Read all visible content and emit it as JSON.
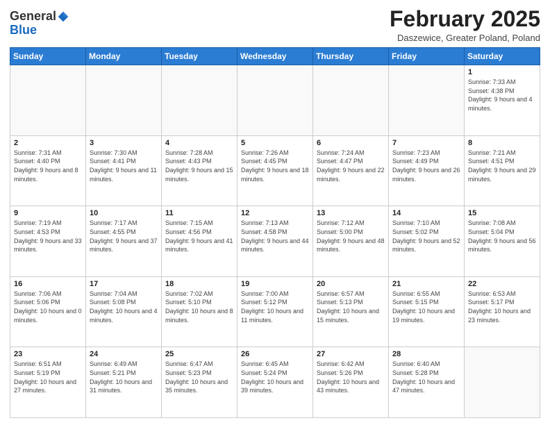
{
  "header": {
    "logo_general": "General",
    "logo_blue": "Blue",
    "main_title": "February 2025",
    "subtitle": "Daszewice, Greater Poland, Poland"
  },
  "weekdays": [
    "Sunday",
    "Monday",
    "Tuesday",
    "Wednesday",
    "Thursday",
    "Friday",
    "Saturday"
  ],
  "weeks": [
    [
      {
        "day": "",
        "info": ""
      },
      {
        "day": "",
        "info": ""
      },
      {
        "day": "",
        "info": ""
      },
      {
        "day": "",
        "info": ""
      },
      {
        "day": "",
        "info": ""
      },
      {
        "day": "",
        "info": ""
      },
      {
        "day": "1",
        "info": "Sunrise: 7:33 AM\nSunset: 4:38 PM\nDaylight: 9 hours and 4 minutes."
      }
    ],
    [
      {
        "day": "2",
        "info": "Sunrise: 7:31 AM\nSunset: 4:40 PM\nDaylight: 9 hours and 8 minutes."
      },
      {
        "day": "3",
        "info": "Sunrise: 7:30 AM\nSunset: 4:41 PM\nDaylight: 9 hours and 11 minutes."
      },
      {
        "day": "4",
        "info": "Sunrise: 7:28 AM\nSunset: 4:43 PM\nDaylight: 9 hours and 15 minutes."
      },
      {
        "day": "5",
        "info": "Sunrise: 7:26 AM\nSunset: 4:45 PM\nDaylight: 9 hours and 18 minutes."
      },
      {
        "day": "6",
        "info": "Sunrise: 7:24 AM\nSunset: 4:47 PM\nDaylight: 9 hours and 22 minutes."
      },
      {
        "day": "7",
        "info": "Sunrise: 7:23 AM\nSunset: 4:49 PM\nDaylight: 9 hours and 26 minutes."
      },
      {
        "day": "8",
        "info": "Sunrise: 7:21 AM\nSunset: 4:51 PM\nDaylight: 9 hours and 29 minutes."
      }
    ],
    [
      {
        "day": "9",
        "info": "Sunrise: 7:19 AM\nSunset: 4:53 PM\nDaylight: 9 hours and 33 minutes."
      },
      {
        "day": "10",
        "info": "Sunrise: 7:17 AM\nSunset: 4:55 PM\nDaylight: 9 hours and 37 minutes."
      },
      {
        "day": "11",
        "info": "Sunrise: 7:15 AM\nSunset: 4:56 PM\nDaylight: 9 hours and 41 minutes."
      },
      {
        "day": "12",
        "info": "Sunrise: 7:13 AM\nSunset: 4:58 PM\nDaylight: 9 hours and 44 minutes."
      },
      {
        "day": "13",
        "info": "Sunrise: 7:12 AM\nSunset: 5:00 PM\nDaylight: 9 hours and 48 minutes."
      },
      {
        "day": "14",
        "info": "Sunrise: 7:10 AM\nSunset: 5:02 PM\nDaylight: 9 hours and 52 minutes."
      },
      {
        "day": "15",
        "info": "Sunrise: 7:08 AM\nSunset: 5:04 PM\nDaylight: 9 hours and 56 minutes."
      }
    ],
    [
      {
        "day": "16",
        "info": "Sunrise: 7:06 AM\nSunset: 5:06 PM\nDaylight: 10 hours and 0 minutes."
      },
      {
        "day": "17",
        "info": "Sunrise: 7:04 AM\nSunset: 5:08 PM\nDaylight: 10 hours and 4 minutes."
      },
      {
        "day": "18",
        "info": "Sunrise: 7:02 AM\nSunset: 5:10 PM\nDaylight: 10 hours and 8 minutes."
      },
      {
        "day": "19",
        "info": "Sunrise: 7:00 AM\nSunset: 5:12 PM\nDaylight: 10 hours and 11 minutes."
      },
      {
        "day": "20",
        "info": "Sunrise: 6:57 AM\nSunset: 5:13 PM\nDaylight: 10 hours and 15 minutes."
      },
      {
        "day": "21",
        "info": "Sunrise: 6:55 AM\nSunset: 5:15 PM\nDaylight: 10 hours and 19 minutes."
      },
      {
        "day": "22",
        "info": "Sunrise: 6:53 AM\nSunset: 5:17 PM\nDaylight: 10 hours and 23 minutes."
      }
    ],
    [
      {
        "day": "23",
        "info": "Sunrise: 6:51 AM\nSunset: 5:19 PM\nDaylight: 10 hours and 27 minutes."
      },
      {
        "day": "24",
        "info": "Sunrise: 6:49 AM\nSunset: 5:21 PM\nDaylight: 10 hours and 31 minutes."
      },
      {
        "day": "25",
        "info": "Sunrise: 6:47 AM\nSunset: 5:23 PM\nDaylight: 10 hours and 35 minutes."
      },
      {
        "day": "26",
        "info": "Sunrise: 6:45 AM\nSunset: 5:24 PM\nDaylight: 10 hours and 39 minutes."
      },
      {
        "day": "27",
        "info": "Sunrise: 6:42 AM\nSunset: 5:26 PM\nDaylight: 10 hours and 43 minutes."
      },
      {
        "day": "28",
        "info": "Sunrise: 6:40 AM\nSunset: 5:28 PM\nDaylight: 10 hours and 47 minutes."
      },
      {
        "day": "",
        "info": ""
      }
    ]
  ]
}
